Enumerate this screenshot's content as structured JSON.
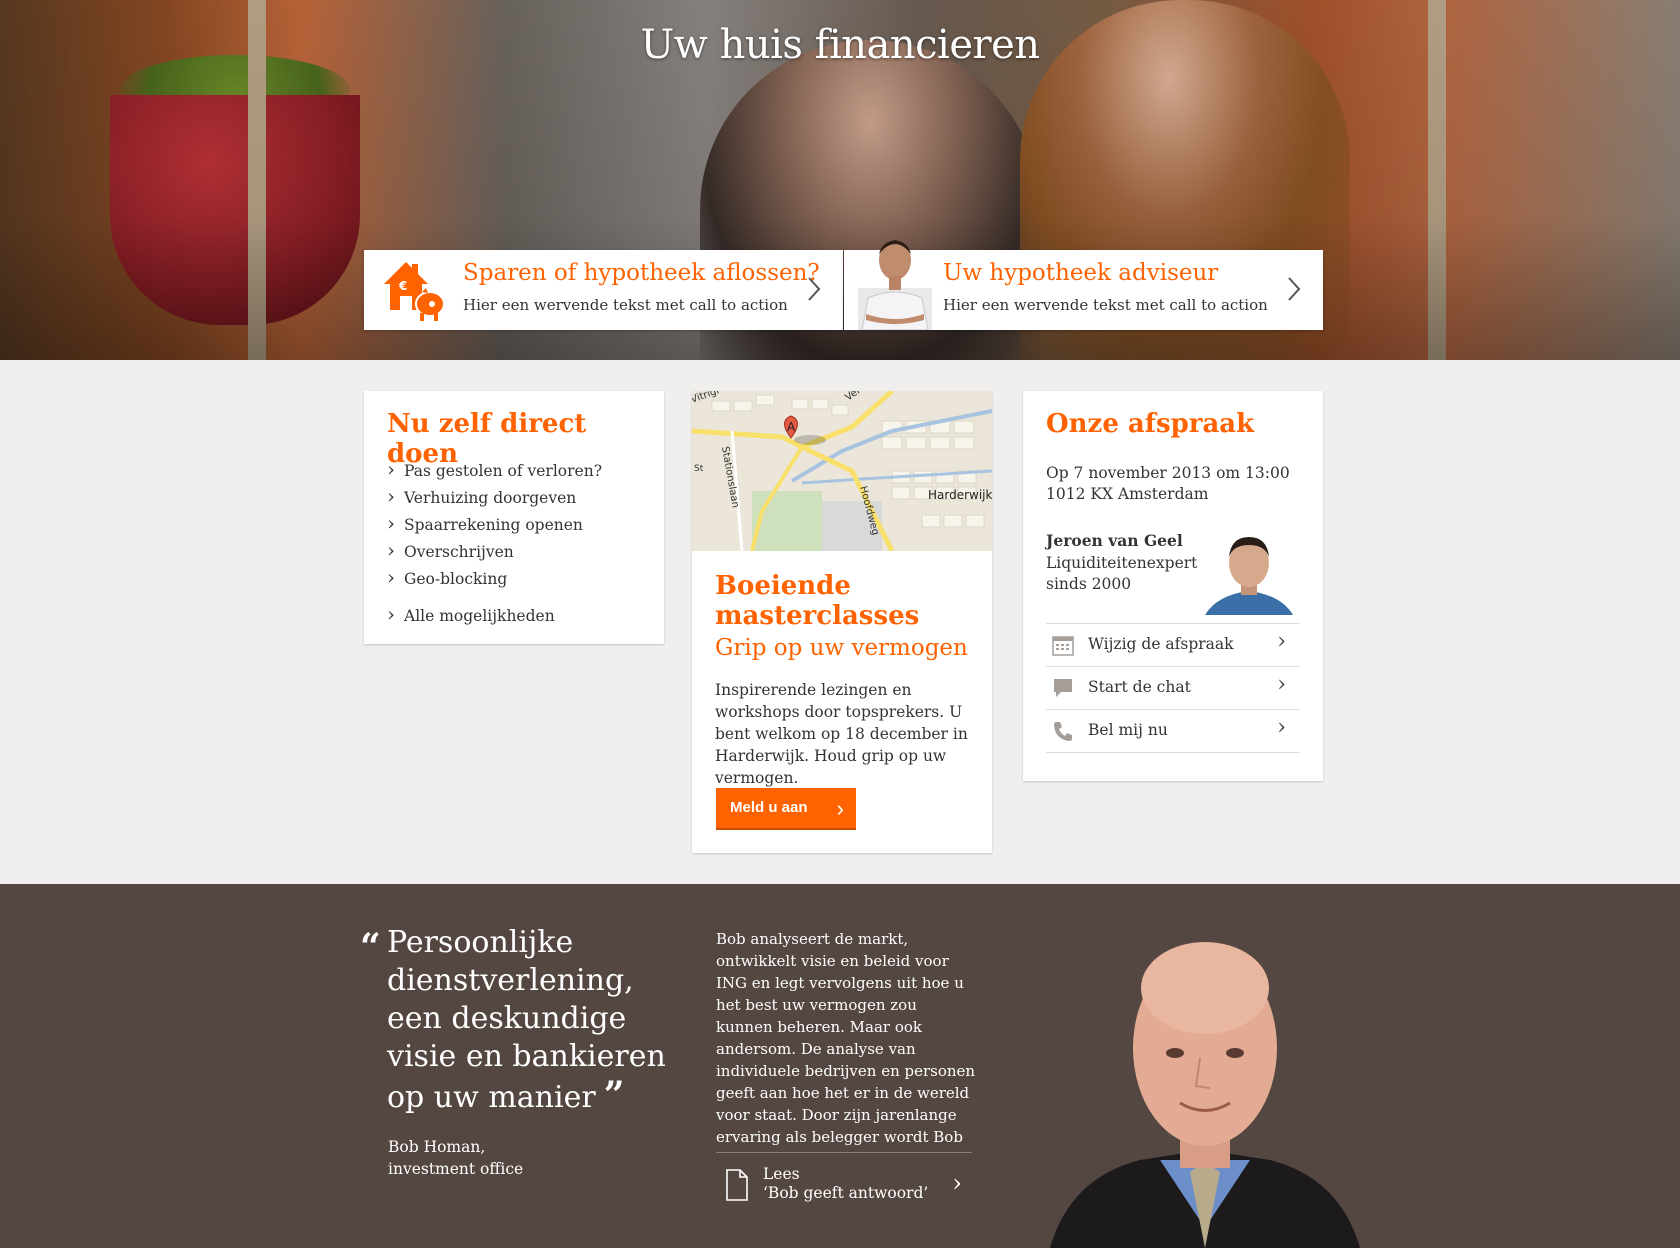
{
  "hero": {
    "title": "Uw huis financieren",
    "promos": [
      {
        "title": "Sparen of hypotheek aflossen?",
        "text": "Hier een wervende tekst met call to action",
        "icon": "house-piggybank-icon"
      },
      {
        "title": "Uw hypotheek adviseur",
        "text": "Hier een wervende tekst met call to action",
        "icon": "advisor-avatar"
      }
    ]
  },
  "direct": {
    "title": "Nu zelf direct doen",
    "items": [
      "Pas gestolen of verloren?",
      "Verhuizing doorgeven",
      "Spaarrekening openen",
      "Overschrijven",
      "Geo-blocking"
    ],
    "all": "Alle mogelijkheden"
  },
  "masterclass": {
    "map_labels": {
      "street1": "Vitrigr",
      "street2": "Verke",
      "street3": "Stationslaan",
      "street4": "Hoofdweg",
      "city": "Harderwijk",
      "marker": "A",
      "street5": "St"
    },
    "title": "Boeiende masterclasses",
    "subtitle": "Grip op uw vermogen",
    "description": "Inspirerende lezingen en workshops door topsprekers. U bent welkom op 18 december in Harderwijk. Houd grip op uw vermogen.",
    "button": "Meld u aan"
  },
  "appointment": {
    "title": "Onze afspraak",
    "date": "Op 7 november 2013 om 13:00",
    "address": "1012 KX Amsterdam",
    "person_name": "Jeroen van Geel",
    "person_role_1": "Liquiditeitenexpert",
    "person_role_2": "sinds 2000",
    "actions": [
      {
        "label": "Wijzig de afspraak",
        "icon": "calendar-icon"
      },
      {
        "label": "Start de chat",
        "icon": "chat-icon"
      },
      {
        "label": "Bel mij nu",
        "icon": "phone-icon"
      }
    ]
  },
  "testimonial": {
    "quote": "Persoonlijke dienstverlening, een deskundige visie en bankieren op uw manier",
    "author_1": "Bob Homan,",
    "author_2": "investment office",
    "bio": "Bob analyseert de markt, ontwikkelt visie en beleid voor ING en legt vervolgens uit hoe u het best uw vermogen zou kunnen beheren. Maar ook andersom. De analyse van individuele bedrijven en personen geeft aan hoe het er in de wereld voor staat. Door zijn jarenlange ervaring als belegger wordt Bob",
    "read_1": "Lees",
    "read_2": "‘Bob geeft antwoord’"
  },
  "colors": {
    "accent": "#ff6200",
    "bottom_bg": "#544641",
    "page_bg": "#f0efee"
  }
}
